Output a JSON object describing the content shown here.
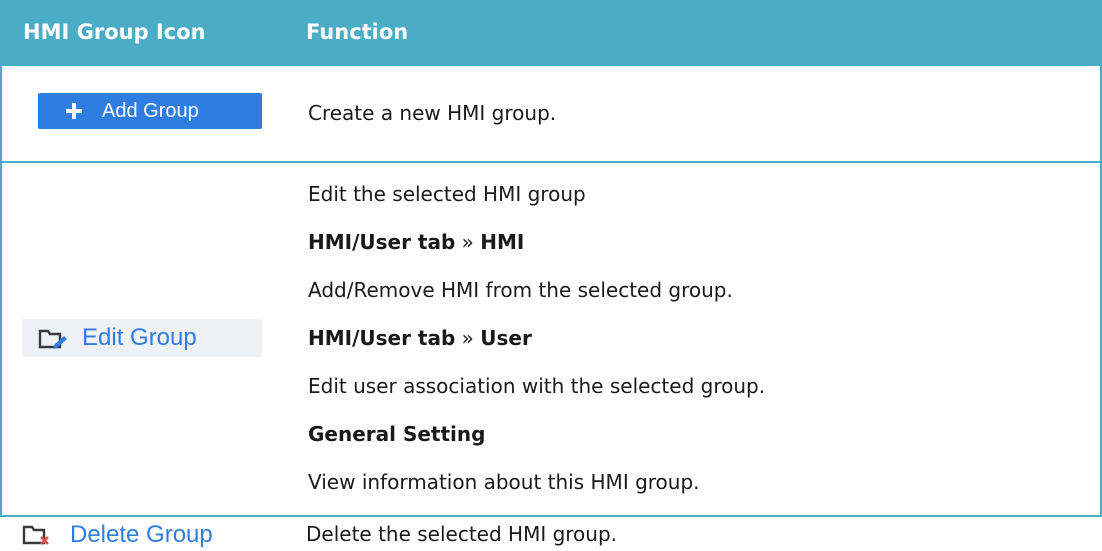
{
  "header": {
    "col1": "HMI Group Icon",
    "col2": "Function"
  },
  "add_row": {
    "button_label": "Add Group",
    "button_icon": "plus-icon",
    "description": "Create a new HMI group."
  },
  "edit_row": {
    "button_label": "Edit Group",
    "button_icon": "folder-edit-icon",
    "lines": {
      "l1": "Edit the selected HMI group",
      "l2_a": "HMI/User tab",
      "l2_sep": " » ",
      "l2_b": "HMI",
      "l3": "Add/Remove HMI from the selected group.",
      "l4_a": "HMI/User tab",
      "l4_sep": " » ",
      "l4_b": "User",
      "l5": "Edit user association with the selected group.",
      "l6": "General Setting",
      "l7": "View information about this HMI group."
    }
  },
  "delete_row": {
    "button_label": "Delete Group",
    "button_icon": "folder-delete-icon",
    "description": "Delete the selected HMI group."
  },
  "colors": {
    "header_bg": "#4bacc6",
    "button_blue": "#2f7de1",
    "edit_button_bg": "#eef1f5",
    "delete_x": "#e0504a"
  }
}
